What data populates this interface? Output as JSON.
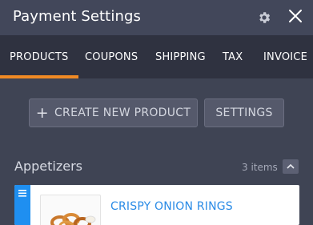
{
  "header": {
    "title": "Payment Settings",
    "gear_icon": "gear-icon",
    "close_icon": "close-icon"
  },
  "tabs": [
    {
      "label": "PRODUCTS",
      "active": true
    },
    {
      "label": "COUPONS",
      "active": false
    },
    {
      "label": "SHIPPING",
      "active": false
    },
    {
      "label": "TAX",
      "active": false
    },
    {
      "label": "INVOICE",
      "active": false
    }
  ],
  "toolbar": {
    "create_label": "CREATE NEW PRODUCT",
    "settings_label": "SETTINGS"
  },
  "category": {
    "title": "Appetizers",
    "count": "3 items"
  },
  "products": [
    {
      "name": "CRISPY ONION RINGS",
      "image_icon": "onion-rings-image"
    }
  ],
  "colors": {
    "accent": "#f08a24",
    "link": "#2a8be6",
    "handle": "#1f8ff0",
    "background": "#3f4454",
    "tabbar": "#2f3240"
  }
}
